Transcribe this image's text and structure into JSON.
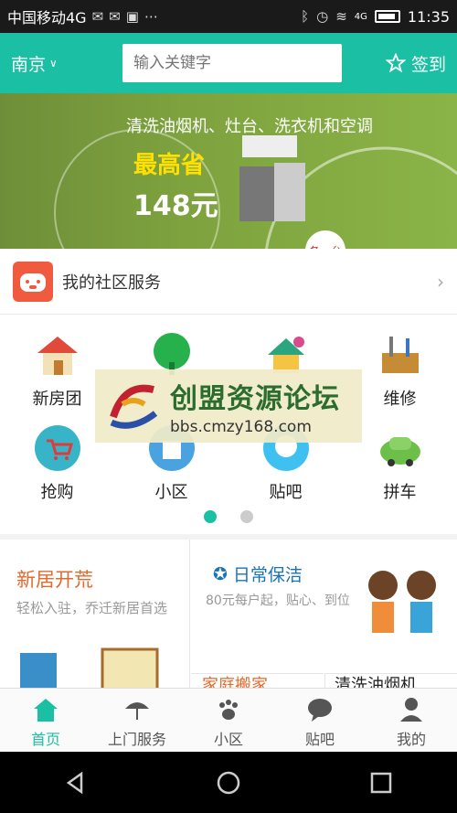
{
  "status_bar": {
    "carrier": "中国移动4G",
    "time": "11:35",
    "network": "4G"
  },
  "header": {
    "city": "南京",
    "search_placeholder": "输入关键字",
    "signin_label": "签到"
  },
  "banner": {
    "headline": "清洗油烟机、灶台、洗衣机和空调",
    "promo": "最高省",
    "price": "148元",
    "badge": "各一台"
  },
  "community": {
    "label": "我的社区服务"
  },
  "services": [
    {
      "label": "新房团",
      "icon": "house-icon"
    },
    {
      "label": "",
      "icon": "tree-icon"
    },
    {
      "label": "",
      "icon": "paint-house-icon"
    },
    {
      "label": "维修",
      "icon": "toolbox-icon"
    },
    {
      "label": "抢购",
      "icon": "cart-icon"
    },
    {
      "label": "小区",
      "icon": "building-icon"
    },
    {
      "label": "贴吧",
      "icon": "chat-bubble-icon"
    },
    {
      "label": "拼车",
      "icon": "car-icon"
    }
  ],
  "watermark": {
    "title": "创盟资源论坛",
    "url": "bbs.cmzy168.com"
  },
  "cards": {
    "left_title": "新居开荒",
    "left_sub": "轻松入驻，乔迁新居首选",
    "right_title": "日常保洁",
    "right_sub": "80元每户起，贴心、到位",
    "mini1": "家庭搬家",
    "mini2": "清洗油烟机"
  },
  "tabs": [
    {
      "label": "首页",
      "icon": "home-icon",
      "active": true
    },
    {
      "label": "上门服务",
      "icon": "umbrella-icon",
      "active": false
    },
    {
      "label": "小区",
      "icon": "paw-icon",
      "active": false
    },
    {
      "label": "贴吧",
      "icon": "chat-icon",
      "active": false
    },
    {
      "label": "我的",
      "icon": "user-icon",
      "active": false
    }
  ],
  "colors": {
    "accent": "#1bbfa3",
    "warm": "#e26a2c",
    "blue": "#1a73b7"
  }
}
